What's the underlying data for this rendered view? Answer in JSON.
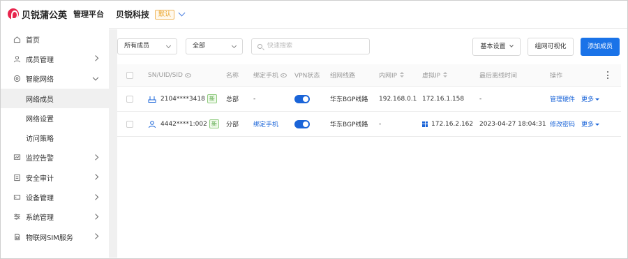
{
  "brand": {
    "name": "贝锐蒲公英",
    "subtitle": "管理平台",
    "logo_color": "#e8254d"
  },
  "header": {
    "org_name": "贝锐科技",
    "default_badge": "默认"
  },
  "sidebar": {
    "items": [
      {
        "label": "首页",
        "icon": "home-icon"
      },
      {
        "label": "成员管理",
        "icon": "user-icon"
      },
      {
        "label": "智能网络",
        "icon": "network-icon",
        "expanded": true
      },
      {
        "label": "网络成员",
        "sub": true,
        "active": true
      },
      {
        "label": "网络设置",
        "sub": true
      },
      {
        "label": "访问策略",
        "sub": true
      },
      {
        "label": "监控告警",
        "icon": "monitor-icon"
      },
      {
        "label": "安全审计",
        "icon": "audit-icon"
      },
      {
        "label": "设备管理",
        "icon": "device-icon"
      },
      {
        "label": "系统管理",
        "icon": "settings-icon"
      },
      {
        "label": "物联网SIM服务",
        "icon": "sim-icon"
      }
    ]
  },
  "toolbar": {
    "member_filter": "所有成员",
    "scope_filter": "全部",
    "search_placeholder": "快速搜索",
    "basic_settings": "基本设置",
    "visualize": "组网可视化",
    "add_member": "添加成员"
  },
  "table": {
    "headers": {
      "sn": "SN/UID/SID",
      "name": "名称",
      "phone": "绑定手机",
      "vpn": "VPN状态",
      "route": "组网线路",
      "lan_ip": "内网IP",
      "virtual_ip": "虚拟IP",
      "last_online": "最后离线时间",
      "actions": "操作"
    },
    "rows": [
      {
        "device_icon": "router-icon",
        "sn": "2104****3418",
        "tag": "新",
        "name": "总部",
        "phone": "-",
        "vpn_on": true,
        "route": "华东BGP线路",
        "lan_ip": "192.168.0.1",
        "virtual_ip": "172.16.1.158",
        "last_online": "-",
        "action": "管理硬件",
        "more": "更多"
      },
      {
        "device_icon": "user-icon",
        "sn": "4442****1:002",
        "tag": "新",
        "name": "分部",
        "phone": "绑定手机",
        "vpn_on": true,
        "route": "华东BGP线路",
        "lan_ip": "-",
        "virtual_ip": "172.16.2.162",
        "virtual_ip_icon": "windows-icon",
        "last_online": "2023-04-27 18:04:31",
        "action": "修改密码",
        "more": "更多"
      }
    ]
  },
  "colors": {
    "primary": "#1a73e8",
    "link": "#1a64d8",
    "new_tag": "#52a441",
    "default_badge": "#e8a020"
  }
}
